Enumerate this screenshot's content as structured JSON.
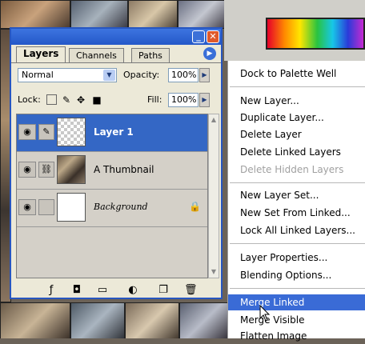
{
  "palette": {
    "tabs": [
      "Layers",
      "Channels",
      "Paths"
    ],
    "blend_mode": "Normal",
    "opacity_label": "Opacity:",
    "opacity_value": "100%",
    "lock_label": "Lock:",
    "fill_label": "Fill:",
    "fill_value": "100%",
    "layers": [
      {
        "name": "Layer 1",
        "selected": true,
        "thumb": "checker"
      },
      {
        "name": "A Thumbnail",
        "selected": false,
        "thumb": "photo"
      },
      {
        "name": "Background",
        "selected": false,
        "thumb": "white"
      }
    ],
    "footer_icons": [
      "layer-style-icon",
      "layer-mask-icon",
      "new-set-icon",
      "adjustment-layer-icon",
      "new-layer-icon",
      "trash-icon"
    ]
  },
  "menu": {
    "items": [
      {
        "label": "Dock to Palette Well"
      },
      {
        "label": "New Layer..."
      },
      {
        "label": "Duplicate Layer..."
      },
      {
        "label": "Delete Layer"
      },
      {
        "label": "Delete Linked Layers"
      },
      {
        "label": "Delete Hidden Layers",
        "disabled": true
      },
      {
        "label": "New Layer Set..."
      },
      {
        "label": "New Set From Linked..."
      },
      {
        "label": "Lock All Linked Layers..."
      },
      {
        "label": "Layer Properties..."
      },
      {
        "label": "Blending Options..."
      },
      {
        "label": "Merge Linked",
        "highlighted": true
      },
      {
        "label": "Merge Visible"
      },
      {
        "label": "Flatten Image"
      }
    ]
  }
}
